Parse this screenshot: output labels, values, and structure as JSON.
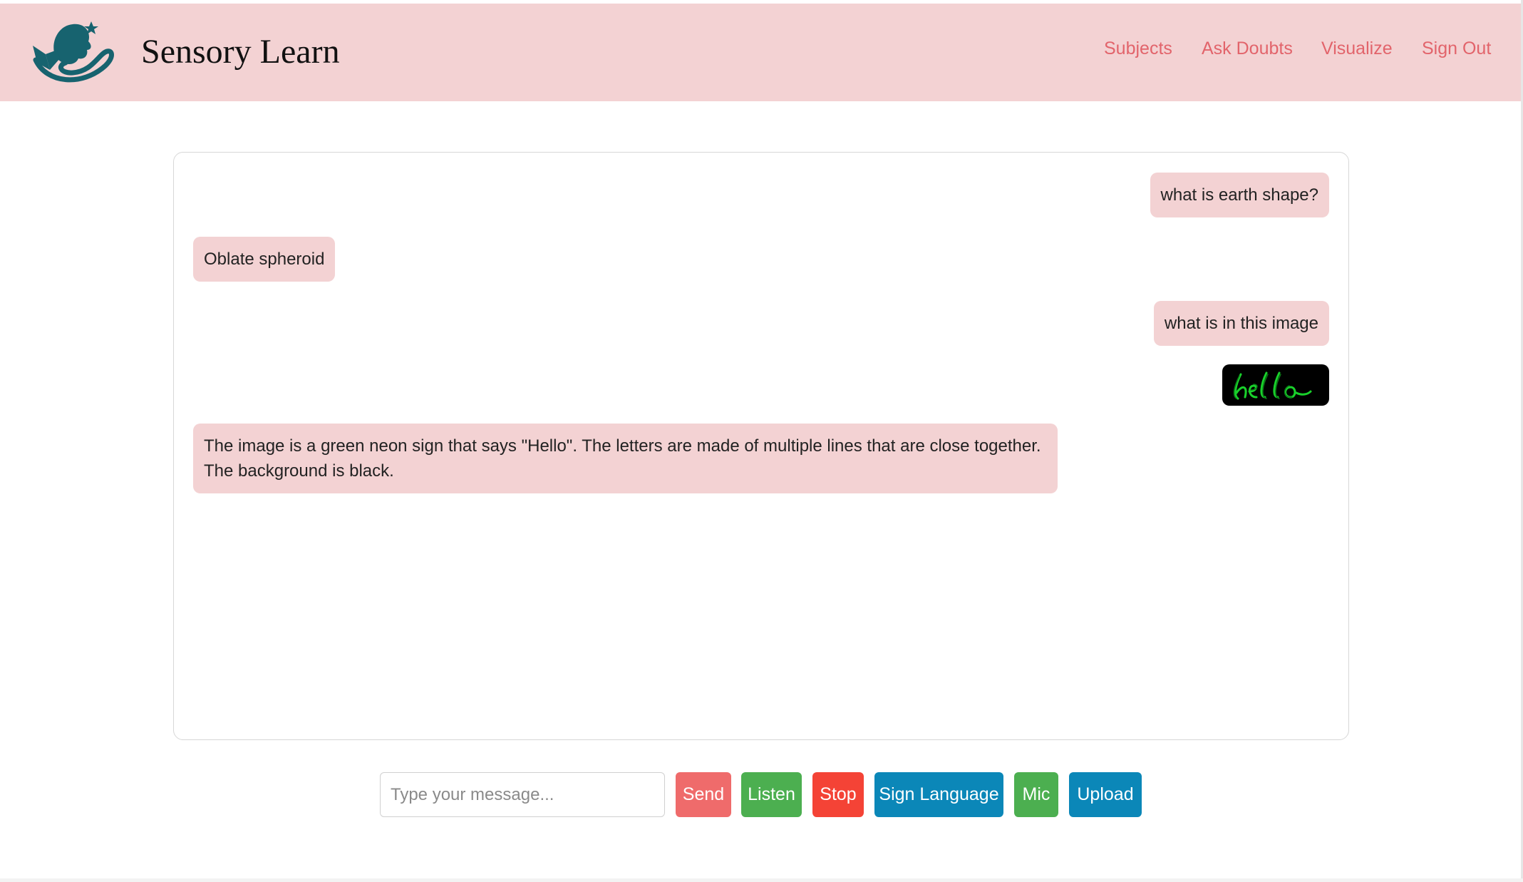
{
  "app": {
    "brand": "Sensory Learn"
  },
  "nav": {
    "items": [
      {
        "label": "Subjects"
      },
      {
        "label": "Ask Doubts"
      },
      {
        "label": "Visualize"
      },
      {
        "label": "Sign Out"
      }
    ]
  },
  "chat": {
    "messages": [
      {
        "role": "user",
        "text": "what is earth shape?"
      },
      {
        "role": "bot",
        "text": "Oblate spheroid"
      },
      {
        "role": "user",
        "text": "what is in this image"
      },
      {
        "role": "user",
        "type": "image",
        "image_text": "hello"
      },
      {
        "role": "bot",
        "text": "The image is a green neon sign that says \"Hello\". The letters are made of multiple lines that are close together. The background is black."
      }
    ]
  },
  "composer": {
    "placeholder": "Type your message...",
    "value": "",
    "buttons": {
      "send": "Send",
      "listen": "Listen",
      "stop": "Stop",
      "sign_language": "Sign Language",
      "mic": "Mic",
      "upload": "Upload"
    }
  },
  "colors": {
    "nav_bg": "#f3d2d3",
    "nav_link": "#e2646b",
    "bubble": "#f3d2d3",
    "send": "#ef6b6b",
    "listen": "#4caf50",
    "stop": "#f44336",
    "sign_language": "#0b87b8",
    "mic": "#4caf50",
    "upload": "#0b87b8",
    "logo": "#17636f"
  }
}
